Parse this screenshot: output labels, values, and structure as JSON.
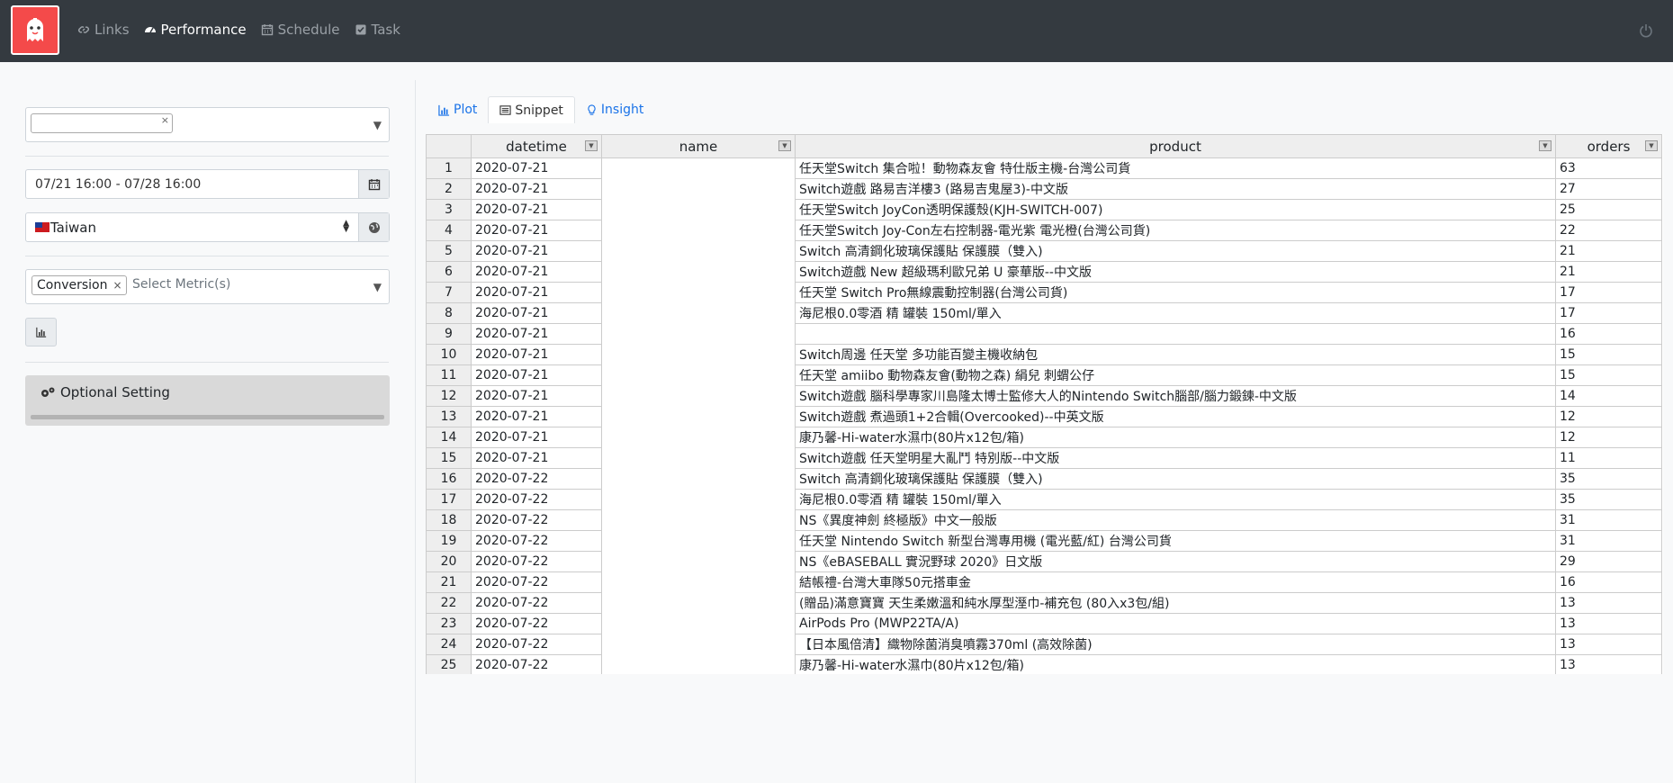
{
  "nav": {
    "items": [
      {
        "label": "Links",
        "icon": "link-icon"
      },
      {
        "label": "Performance",
        "icon": "dashboard-icon"
      },
      {
        "label": "Schedule",
        "icon": "calendar-icon"
      },
      {
        "label": "Task",
        "icon": "check-square-icon"
      }
    ]
  },
  "sidebar": {
    "date_range": "07/21 16:00 - 07/28 16:00",
    "country": "Taiwan",
    "metric_tag": "Conversion",
    "metric_placeholder": "Select Metric(s)",
    "optional_setting": "Optional Setting"
  },
  "tabs": [
    {
      "label": "Plot",
      "icon": "bar-chart-icon"
    },
    {
      "label": "Snippet",
      "icon": "list-icon"
    },
    {
      "label": "Insight",
      "icon": "lightbulb-icon"
    }
  ],
  "table": {
    "columns": [
      "datetime",
      "name",
      "product",
      "orders"
    ],
    "rows": [
      {
        "idx": "1",
        "datetime": "2020-07-21",
        "product": "任天堂Switch 集合啦！動物森友會 特仕版主機-台灣公司貨",
        "orders": "63"
      },
      {
        "idx": "2",
        "datetime": "2020-07-21",
        "product": "Switch遊戲 路易吉洋樓3 (路易吉鬼屋3)-中文版",
        "orders": "27"
      },
      {
        "idx": "3",
        "datetime": "2020-07-21",
        "product": "任天堂Switch JoyCon透明保護殼(KJH-SWITCH-007)",
        "orders": "25"
      },
      {
        "idx": "4",
        "datetime": "2020-07-21",
        "product": "任天堂Switch Joy-Con左右控制器-電光紫 電光橙(台灣公司貨)",
        "orders": "22"
      },
      {
        "idx": "5",
        "datetime": "2020-07-21",
        "product": "Switch 高清鋼化玻璃保護貼 保護膜（雙入)",
        "orders": "21"
      },
      {
        "idx": "6",
        "datetime": "2020-07-21",
        "product": "Switch遊戲 New 超級瑪利歐兄弟 U 豪華版--中文版",
        "orders": "21"
      },
      {
        "idx": "7",
        "datetime": "2020-07-21",
        "product": "任天堂 Switch Pro無線震動控制器(台灣公司貨)",
        "orders": "17"
      },
      {
        "idx": "8",
        "datetime": "2020-07-21",
        "product": "海尼根0.0零酒 精 罐裝 150ml/單入",
        "orders": "17"
      },
      {
        "idx": "9",
        "datetime": "2020-07-21",
        "product": "",
        "orders": "16"
      },
      {
        "idx": "10",
        "datetime": "2020-07-21",
        "product": "Switch周邊 任天堂 多功能百變主機收納包",
        "orders": "15"
      },
      {
        "idx": "11",
        "datetime": "2020-07-21",
        "product": "任天堂 amiibo 動物森友會(動物之森) 絹兒 刺蝟公仔",
        "orders": "15"
      },
      {
        "idx": "12",
        "datetime": "2020-07-21",
        "product": "Switch遊戲 腦科學專家川島隆太博士監修大人的Nintendo Switch腦部/腦力鍛鍊-中文版",
        "orders": "14"
      },
      {
        "idx": "13",
        "datetime": "2020-07-21",
        "product": "Switch遊戲 煮過頭1+2合輯(Overcooked)--中英文版",
        "orders": "12"
      },
      {
        "idx": "14",
        "datetime": "2020-07-21",
        "product": "康乃馨-Hi-water水濕巾(80片x12包/箱)",
        "orders": "12"
      },
      {
        "idx": "15",
        "datetime": "2020-07-21",
        "product": "Switch遊戲 任天堂明星大亂鬥 特別版--中文版",
        "orders": "11"
      },
      {
        "idx": "16",
        "datetime": "2020-07-22",
        "product": "Switch 高清鋼化玻璃保護貼 保護膜（雙入)",
        "orders": "35"
      },
      {
        "idx": "17",
        "datetime": "2020-07-22",
        "product": "海尼根0.0零酒 精 罐裝 150ml/單入",
        "orders": "35"
      },
      {
        "idx": "18",
        "datetime": "2020-07-22",
        "product": "NS《異度神劍 終極版》中文一般版",
        "orders": "31"
      },
      {
        "idx": "19",
        "datetime": "2020-07-22",
        "product": "任天堂 Nintendo Switch 新型台灣專用機 (電光藍/紅) 台灣公司貨",
        "orders": "31"
      },
      {
        "idx": "20",
        "datetime": "2020-07-22",
        "product": "NS《eBASEBALL 實況野球 2020》日文版",
        "orders": "29"
      },
      {
        "idx": "21",
        "datetime": "2020-07-22",
        "product": "結帳禮-台灣大車隊50元搭車金",
        "orders": "16"
      },
      {
        "idx": "22",
        "datetime": "2020-07-22",
        "product": "(贈品)滿意寶寶 天生柔嫩溫和純水厚型溼巾-補充包 (80入x3包/組)",
        "orders": "13"
      },
      {
        "idx": "23",
        "datetime": "2020-07-22",
        "product": "AirPods Pro (MWP22TA/A)",
        "orders": "13"
      },
      {
        "idx": "24",
        "datetime": "2020-07-22",
        "product": "【日本風倍清】織物除菌消臭噴霧370ml (高效除菌)",
        "orders": "13"
      },
      {
        "idx": "25",
        "datetime": "2020-07-22",
        "product": "康乃馨-Hi-water水濕巾(80片x12包/箱)",
        "orders": "13"
      }
    ]
  }
}
